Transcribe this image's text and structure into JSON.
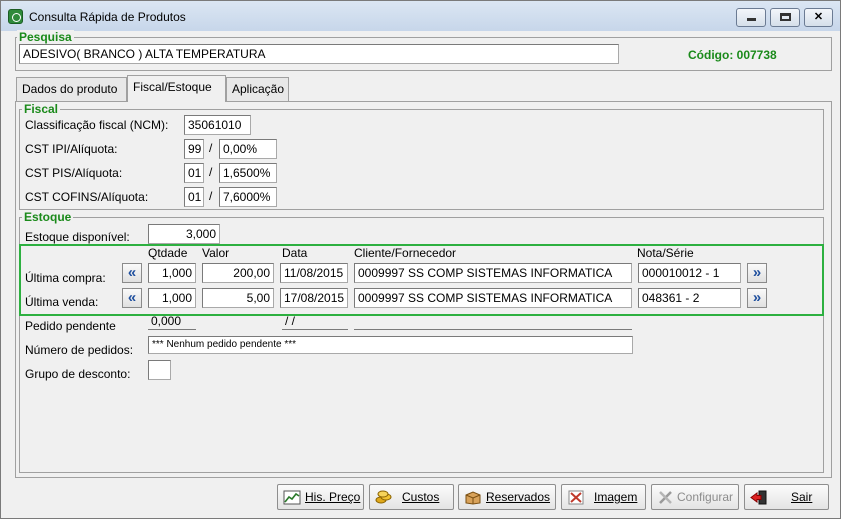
{
  "window": {
    "title": "Consulta Rápida de Produtos"
  },
  "pesquisa": {
    "label": "Pesquisa",
    "value": "ADESIVO( BRANCO ) ALTA TEMPERATURA",
    "codigo": "Código: 007738"
  },
  "tabs": [
    {
      "label": "Dados do produto",
      "active": false
    },
    {
      "label": "Fiscal/Estoque",
      "active": true
    },
    {
      "label": "Aplicação",
      "active": false
    }
  ],
  "fiscal": {
    "title": "Fiscal",
    "ncm_label": "Classificação fiscal (NCM):",
    "ncm_value": "35061010",
    "ipi_label": "CST IPI/Alíquota:",
    "ipi_cst": "99",
    "ipi_aliq": "0,00%",
    "pis_label": "CST PIS/Alíquota:",
    "pis_cst": "01",
    "pis_aliq": "1,6500%",
    "cofins_label": "CST COFINS/Alíquota:",
    "cofins_cst": "01",
    "cofins_aliq": "7,6000%",
    "sep": "/"
  },
  "estoque": {
    "title": "Estoque",
    "disponivel_label": "Estoque disponível:",
    "disponivel_value": "3,000",
    "headers": {
      "qtdade": "Qtdade",
      "valor": "Valor",
      "data": "Data",
      "cliente": "Cliente/Fornecedor",
      "nota": "Nota/Série"
    },
    "ultima_compra": {
      "label": "Última compra:",
      "qtdade": "1,000",
      "valor": "200,00",
      "data": "11/08/2015",
      "cliente": "0009997 SS COMP SISTEMAS INFORMATICA",
      "nota": "000010012 - 1"
    },
    "ultima_venda": {
      "label": "Última venda:",
      "qtdade": "1,000",
      "valor": "5,00",
      "data": "17/08/2015",
      "cliente": "0009997 SS COMP SISTEMAS INFORMATICA",
      "nota": "048361 - 2"
    },
    "pedido_pendente": {
      "label": "Pedido pendente",
      "qtdade": "0,000",
      "data": " / /"
    },
    "numero_pedidos": {
      "label": "Número de pedidos:",
      "value": "*** Nenhum pedido pendente ***"
    },
    "grupo_desconto": {
      "label": "Grupo de desconto:",
      "value": ""
    }
  },
  "buttons": {
    "his_preco": "His. Preço",
    "custos": "Custos",
    "reservados": "Reservados",
    "imagem": "Imagem",
    "configurar": "Configurar",
    "sair": "Sair"
  },
  "icons": {
    "prev": "double-chevron-left-icon",
    "next": "double-chevron-right-icon"
  }
}
